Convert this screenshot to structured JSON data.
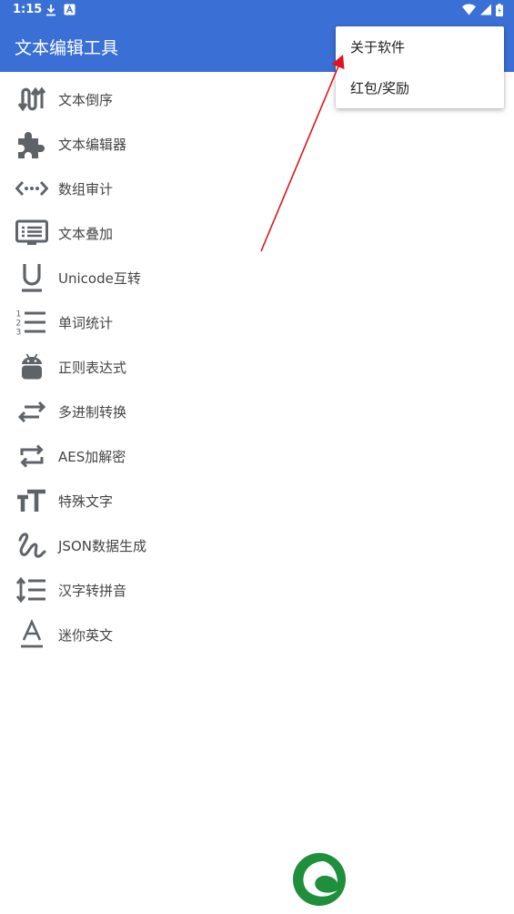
{
  "status": {
    "time": "1:15"
  },
  "app": {
    "title": "文本编辑工具"
  },
  "menu": {
    "items": [
      "关于软件",
      "红包/奖励"
    ]
  },
  "tools": [
    {
      "label": "文本倒序",
      "icon": "swap-vertical-icon"
    },
    {
      "label": "文本编辑器",
      "icon": "puzzle-icon"
    },
    {
      "label": "数组审计",
      "icon": "code-dots-icon"
    },
    {
      "label": "文本叠加",
      "icon": "subtitles-monitor-icon"
    },
    {
      "label": "Unicode互转",
      "icon": "underline-icon"
    },
    {
      "label": "单词统计",
      "icon": "numbered-list-icon"
    },
    {
      "label": "正则表达式",
      "icon": "android-icon"
    },
    {
      "label": "多进制转换",
      "icon": "swap-horizontal-icon"
    },
    {
      "label": "AES加解密",
      "icon": "repeat-icon"
    },
    {
      "label": "特殊文字",
      "icon": "text-size-icon"
    },
    {
      "label": "JSON数据生成",
      "icon": "gesture-icon"
    },
    {
      "label": "汉字转拼音",
      "icon": "line-spacing-icon"
    },
    {
      "label": "迷你英文",
      "icon": "font-a-icon"
    }
  ],
  "colors": {
    "primary": "#3a6fd6",
    "icon": "#5f6368",
    "annotation_arrow": "#e0141e",
    "logo_green": "#1e8f3a"
  }
}
